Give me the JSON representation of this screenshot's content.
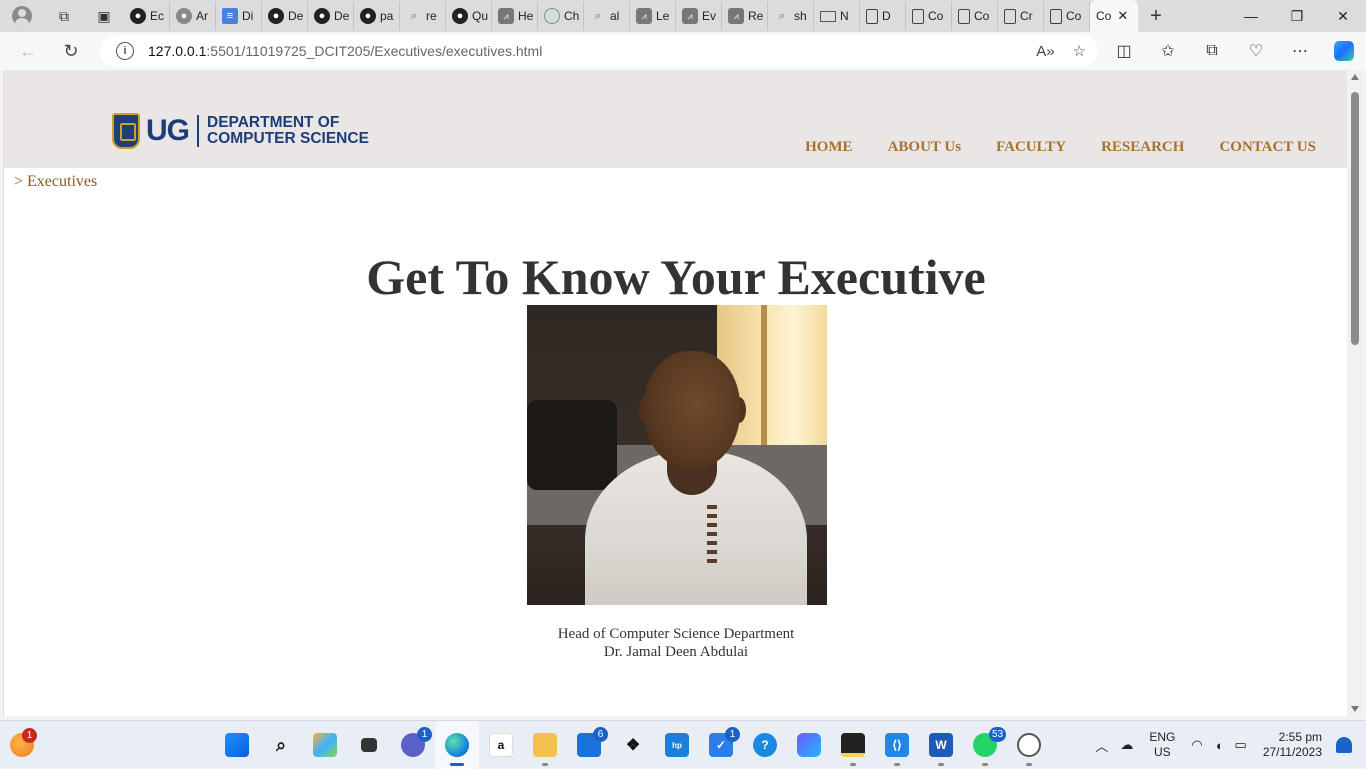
{
  "browser": {
    "tabs": [
      {
        "favicon": "github-icon",
        "title": "Ec"
      },
      {
        "favicon": "github-icon",
        "title": "Ar"
      },
      {
        "favicon": "docs-icon",
        "title": "Di"
      },
      {
        "favicon": "github-icon",
        "title": "De"
      },
      {
        "favicon": "github-icon",
        "title": "De"
      },
      {
        "favicon": "github-icon",
        "title": "pa"
      },
      {
        "favicon": "search-icon",
        "title": "re"
      },
      {
        "favicon": "github-icon",
        "title": "Qu"
      },
      {
        "favicon": "code-icon",
        "title": "He"
      },
      {
        "favicon": "chatgpt-icon",
        "title": "Ch"
      },
      {
        "favicon": "search-icon",
        "title": "al"
      },
      {
        "favicon": "code-icon",
        "title": "Le"
      },
      {
        "favicon": "code-icon",
        "title": "Ev"
      },
      {
        "favicon": "code-icon",
        "title": "Re"
      },
      {
        "favicon": "search-icon",
        "title": "sh"
      },
      {
        "favicon": "mail-icon",
        "title": "N"
      },
      {
        "favicon": "page-icon",
        "title": "D"
      },
      {
        "favicon": "page-icon",
        "title": "Co"
      },
      {
        "favicon": "page-icon",
        "title": "Co"
      },
      {
        "favicon": "page-icon",
        "title": "Cr"
      },
      {
        "favicon": "page-icon",
        "title": "Co"
      }
    ],
    "active_tab": {
      "title": "Co"
    },
    "url_host": "127.0.0.1",
    "url_rest": ":5501/11019725_DCIT205/Executives/executives.html"
  },
  "site": {
    "logo_ug": "UG",
    "logo_line1": "DEPARTMENT OF",
    "logo_line2": "COMPUTER SCIENCE",
    "nav": [
      "HOME",
      "ABOUT Us",
      "FACULTY",
      "RESEARCH",
      "CONTACT US"
    ],
    "breadcrumb": "> Executives",
    "heading": "Get To Know Your Executive",
    "caption_role": "Head of Computer Science Department",
    "caption_name": "Dr. Jamal Deen Abdulai"
  },
  "taskbar": {
    "weather_badge": "1",
    "teams_badge": "1",
    "mail_badge": "6",
    "todo_badge": "1",
    "whatsapp_badge": "53",
    "lang_line1": "ENG",
    "lang_line2": "US",
    "time": "2:55 pm",
    "date": "27/11/2023"
  },
  "colors": {
    "header_bg": "#eae6e5",
    "nav_link": "#a8732a",
    "logo_blue": "#1b3e78",
    "breadcrumb": "#8d5a1c"
  }
}
